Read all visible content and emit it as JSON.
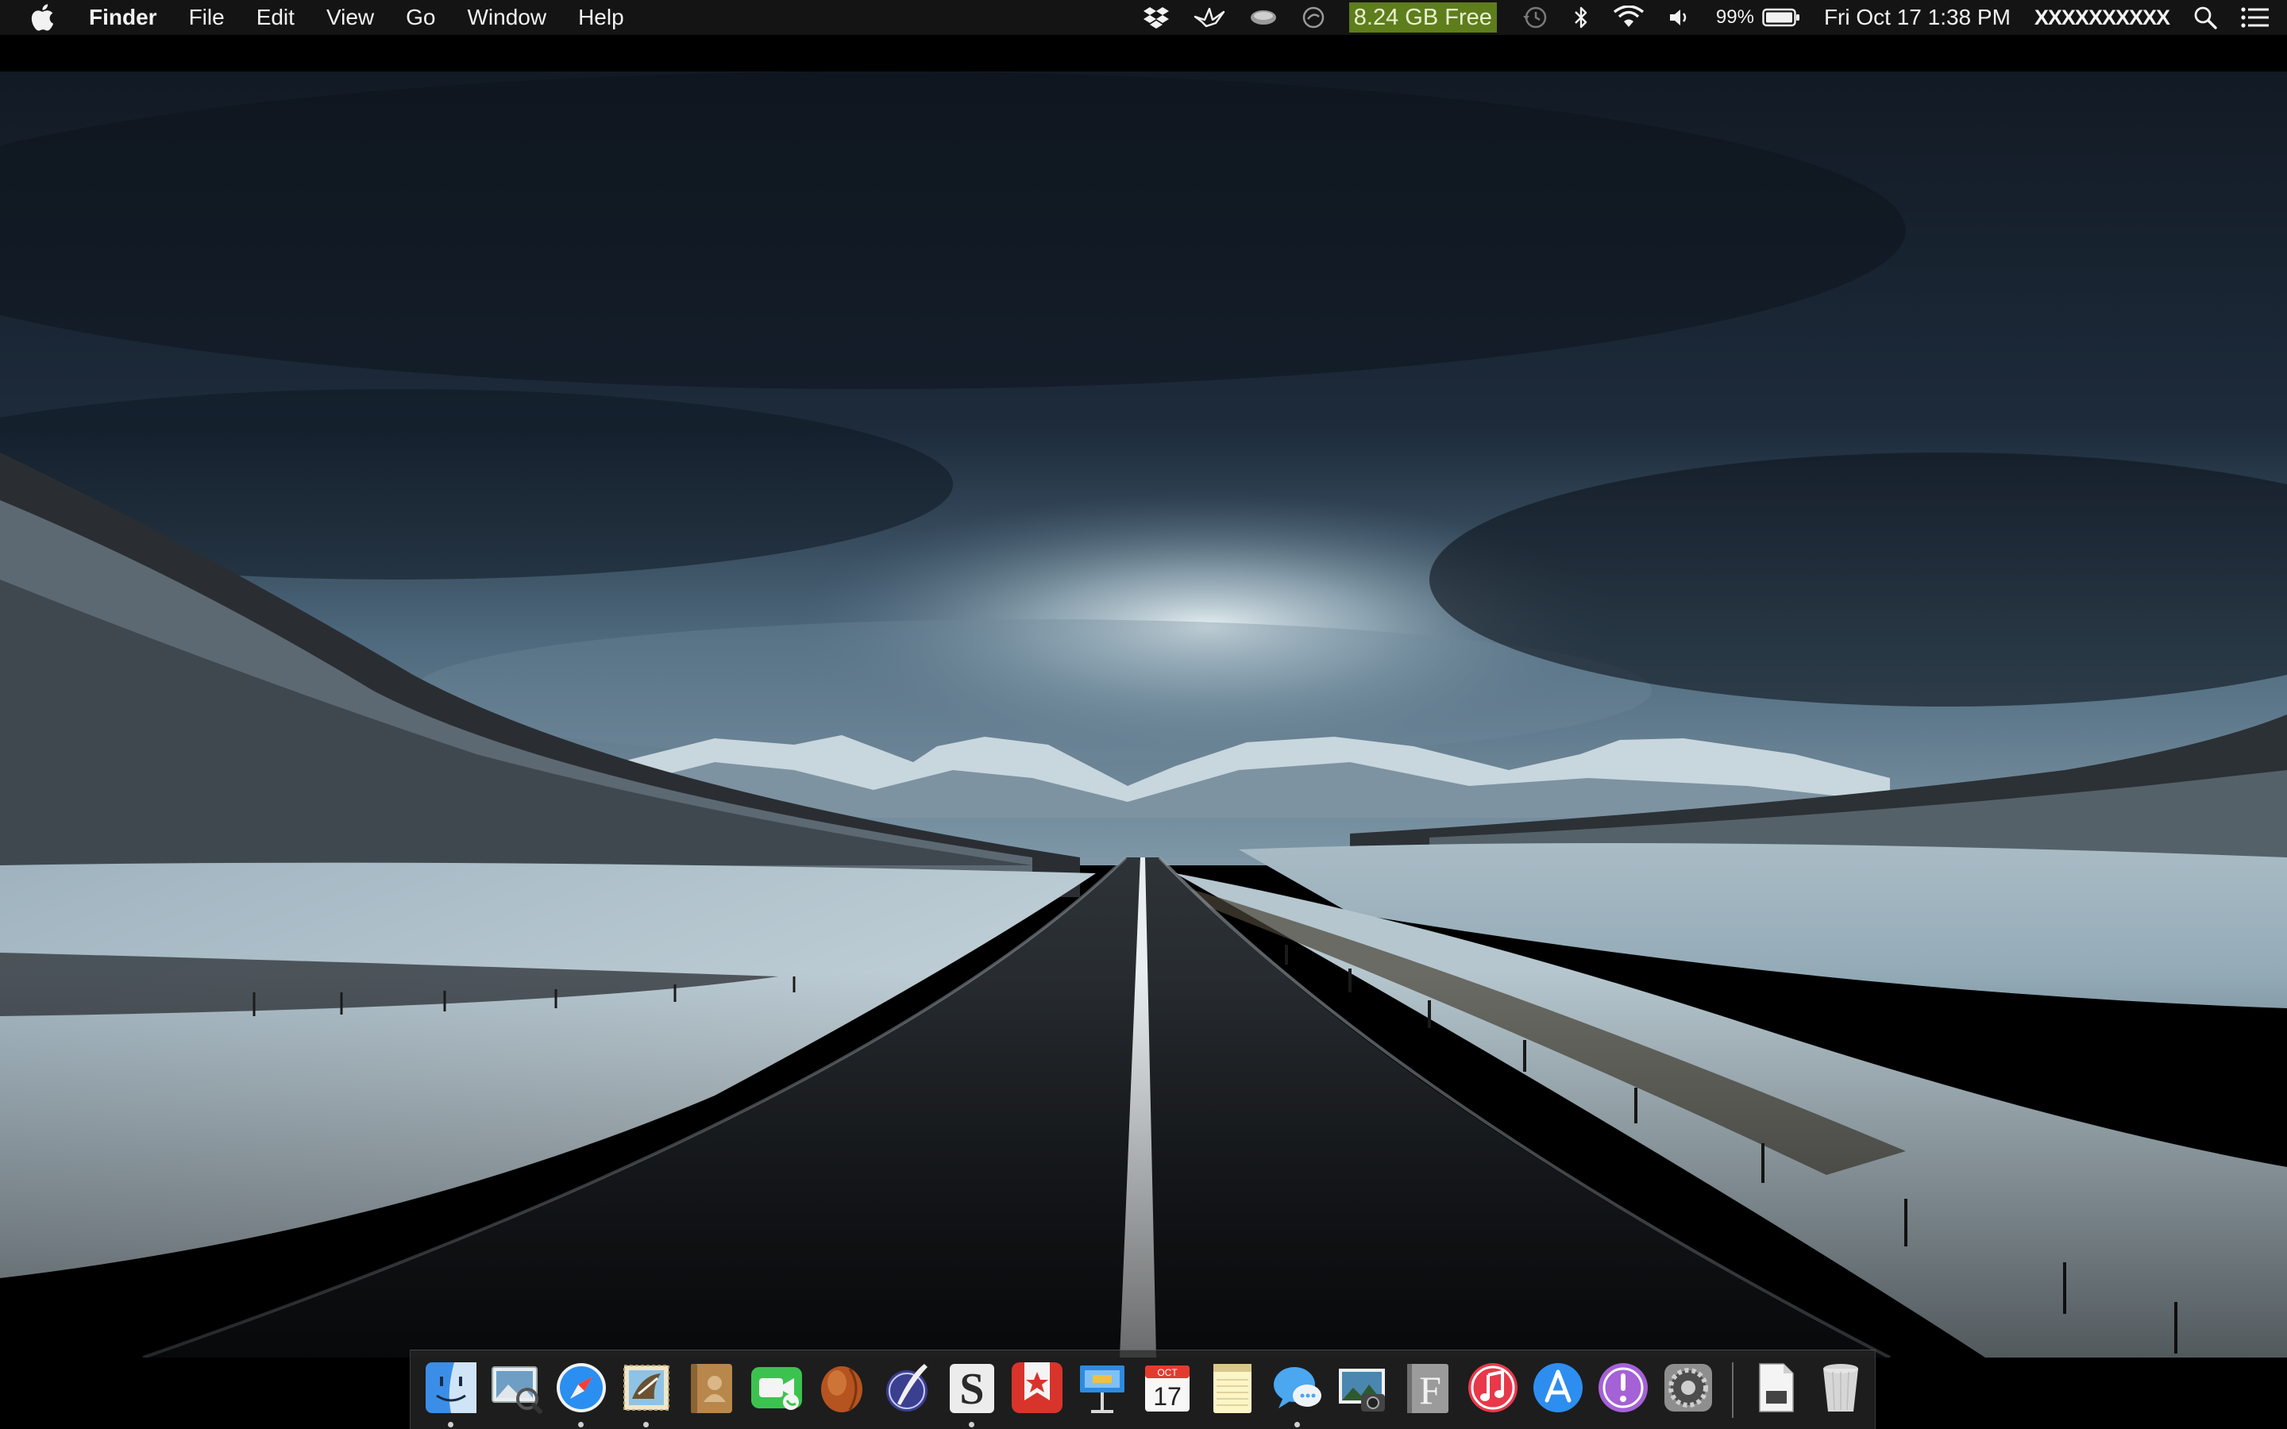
{
  "menubar": {
    "app_name": "Finder",
    "menus": [
      "File",
      "Edit",
      "View",
      "Go",
      "Window",
      "Help"
    ],
    "disk_free": "8.24 GB Free",
    "battery_percent": "99%",
    "datetime": "Fri Oct 17  1:38 PM",
    "username": "XXXXXXXXXX",
    "status_icons": [
      "dropbox-icon",
      "crane-icon",
      "disk-icon",
      "sync-icon",
      "time-machine-icon",
      "bluetooth-icon",
      "wifi-icon",
      "volume-icon",
      "battery-icon",
      "spotlight-icon",
      "notification-center-icon"
    ]
  },
  "dock": {
    "calendar_month": "OCT",
    "calendar_day": "17",
    "items": [
      {
        "name": "finder",
        "running": true
      },
      {
        "name": "preview",
        "running": false
      },
      {
        "name": "safari",
        "running": true
      },
      {
        "name": "mail",
        "running": true
      },
      {
        "name": "contacts",
        "running": false
      },
      {
        "name": "facetime",
        "running": false
      },
      {
        "name": "coconut",
        "running": false
      },
      {
        "name": "quill",
        "running": false
      },
      {
        "name": "scrivener",
        "running": true
      },
      {
        "name": "wunderlist",
        "running": false
      },
      {
        "name": "keynote",
        "running": false
      },
      {
        "name": "calendar",
        "running": false
      },
      {
        "name": "notes",
        "running": false
      },
      {
        "name": "messages",
        "running": true
      },
      {
        "name": "iphoto",
        "running": false
      },
      {
        "name": "font-book",
        "running": false
      },
      {
        "name": "itunes",
        "running": false
      },
      {
        "name": "app-store",
        "running": false
      },
      {
        "name": "feedback",
        "running": false
      },
      {
        "name": "system-preferences",
        "running": false
      },
      {
        "name": "document",
        "running": false
      },
      {
        "name": "trash",
        "running": false
      }
    ]
  },
  "colors": {
    "menubar_bg": "#141414",
    "disk_free_bg": "#5e7d1c",
    "sky_dark": "#1a2635",
    "road": "#22262b"
  }
}
